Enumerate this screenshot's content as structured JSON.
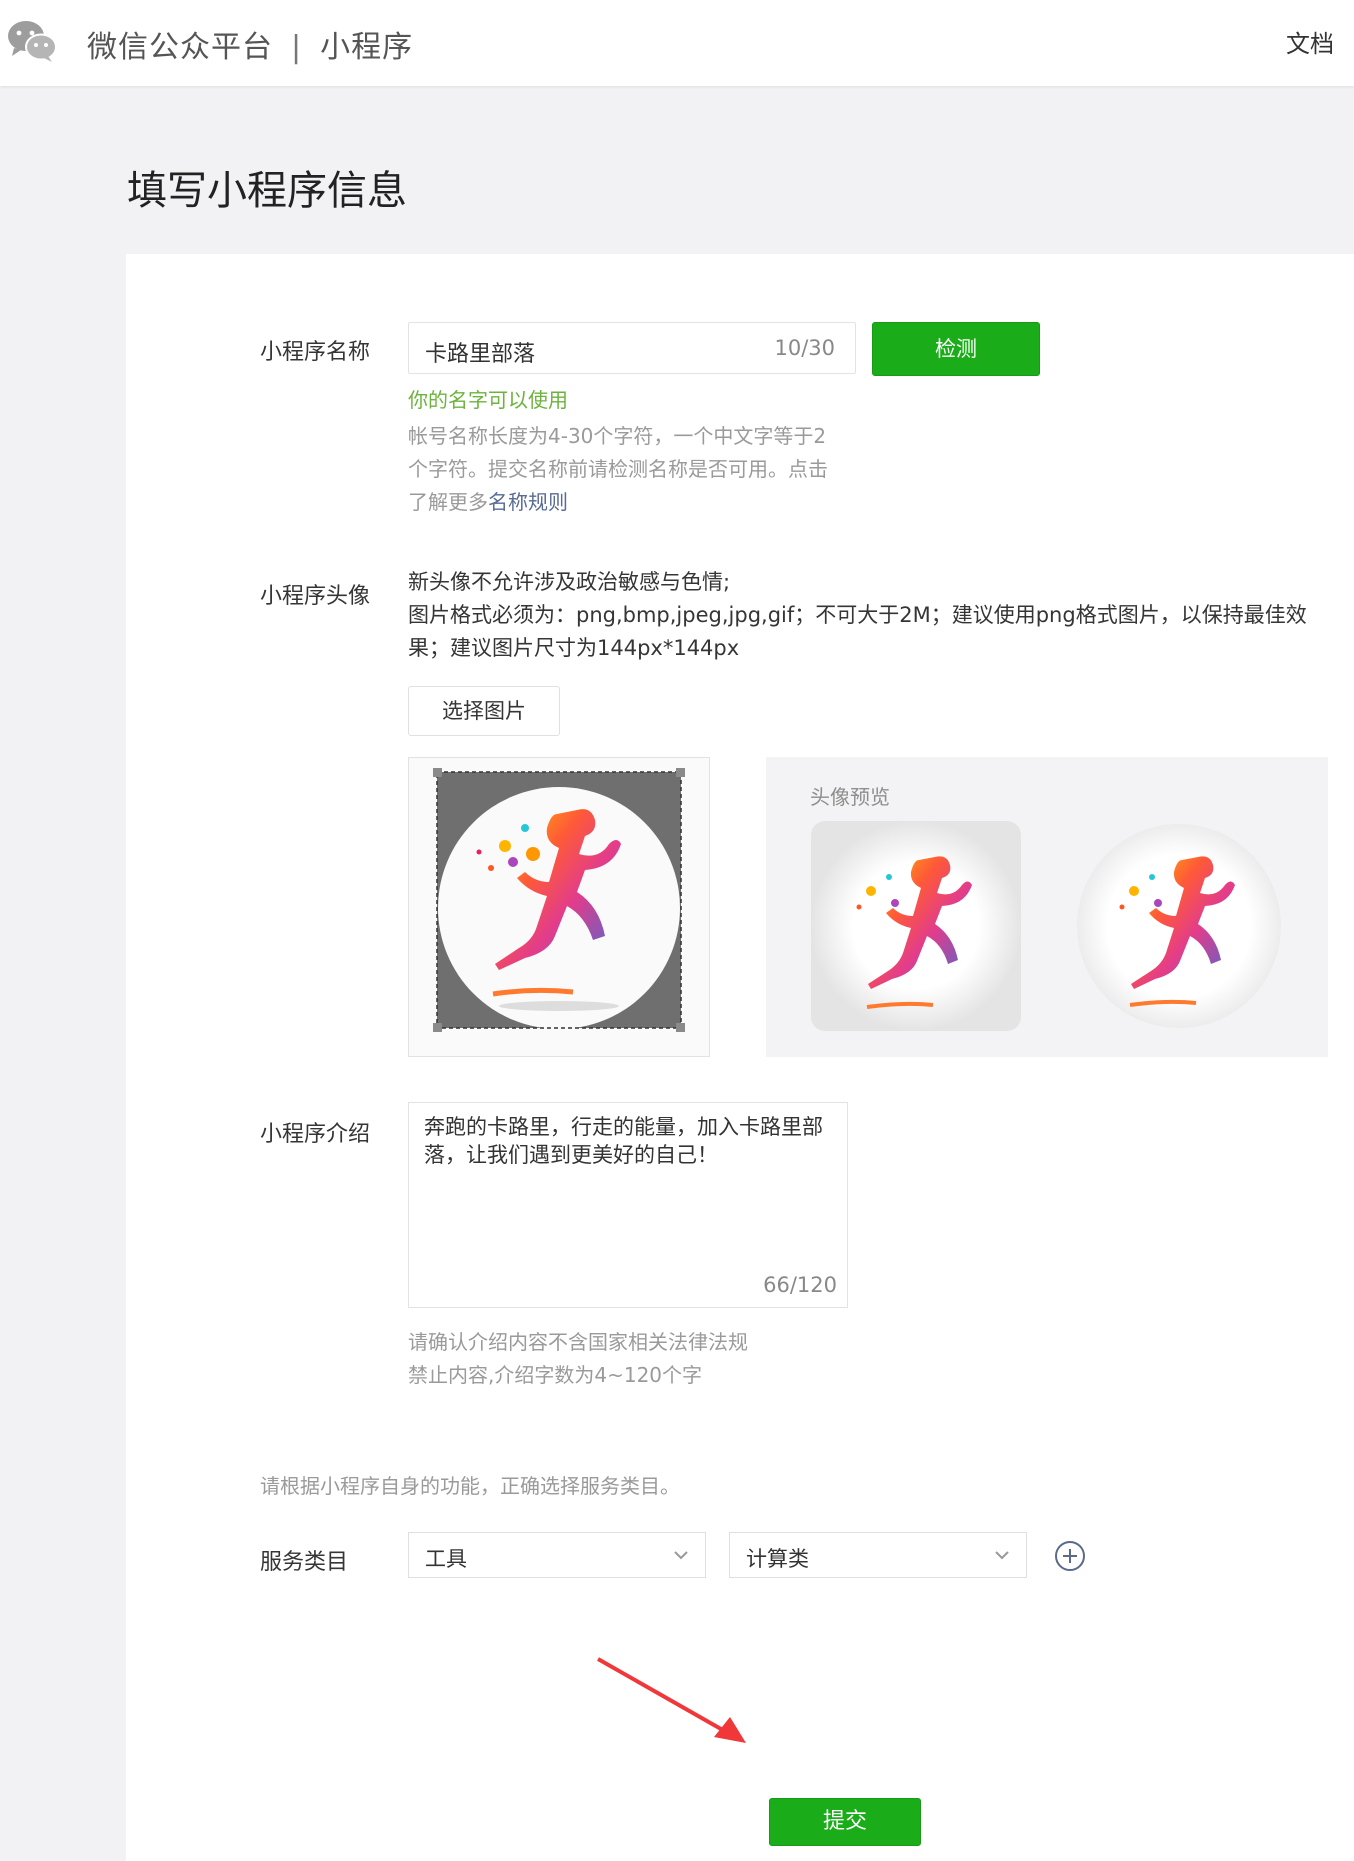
{
  "header": {
    "brand_name": "微信公众平台",
    "separator": "|",
    "section": "小程序",
    "doc_link": "文档"
  },
  "page_title": "填写小程序信息",
  "name_field": {
    "label": "小程序名称",
    "value": "卡路里部落",
    "counter": "10/30",
    "check_button": "检测",
    "success_tip": "你的名字可以使用",
    "hint_line1": "帐号名称长度为4-30个字符，一个中文字等于2",
    "hint_line2": "个字符。提交名称前请检测名称是否可用。点击",
    "hint_line3_prefix": "了解更多",
    "hint_link": "名称规则"
  },
  "avatar_field": {
    "label": "小程序头像",
    "note_line1": "新头像不允许涉及政治敏感与色情;",
    "note_line2": "图片格式必须为：png,bmp,jpeg,jpg,gif；不可大于2M；建议使用png格式图片，以保持最佳效果；建议图片尺寸为144px*144px",
    "choose_button": "选择图片",
    "preview_title": "头像预览"
  },
  "intro_field": {
    "label": "小程序介绍",
    "value": "奔跑的卡路里，行走的能量，加入卡路里部落，让我们遇到更美好的自己！",
    "counter": "66/120",
    "hint_line1": "请确认介绍内容不含国家相关法律法规",
    "hint_line2": "禁止内容,介绍字数为4~120个字"
  },
  "service": {
    "note": "请根据小程序自身的功能，正确选择服务类目。",
    "label": "服务类目",
    "category1": "工具",
    "category2": "计算类"
  },
  "submit_button": "提交",
  "colors": {
    "brand_green": "#1aad19",
    "success_text": "#6cb33e",
    "link": "#576b95",
    "annotation_arrow": "#f0373a"
  }
}
